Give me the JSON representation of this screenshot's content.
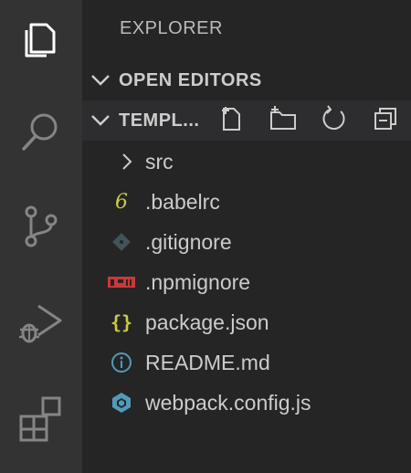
{
  "activity_bar": {
    "items": [
      {
        "icon": "files-icon",
        "active": true
      },
      {
        "icon": "search-icon",
        "active": false
      },
      {
        "icon": "source-control-icon",
        "active": false
      },
      {
        "icon": "run-debug-icon",
        "active": false
      },
      {
        "icon": "extensions-icon",
        "active": false
      }
    ]
  },
  "sidebar": {
    "title": "EXPLORER",
    "open_editors_label": "OPEN EDITORS",
    "project_label": "TEMPL...",
    "toolbar": [
      "new-file-icon",
      "new-folder-icon",
      "refresh-icon",
      "collapse-all-icon"
    ]
  },
  "tree": {
    "items": [
      {
        "label": "src",
        "icon": "chevron-right-icon"
      },
      {
        "label": ".babelrc",
        "icon": "babel-icon",
        "color": "#cbcb41"
      },
      {
        "label": ".gitignore",
        "icon": "git-icon",
        "color": "#41535b"
      },
      {
        "label": ".npmignore",
        "icon": "npm-icon",
        "color": "#cb3837"
      },
      {
        "label": "package.json",
        "icon": "json-icon",
        "color": "#cbcb41"
      },
      {
        "label": "README.md",
        "icon": "info-icon",
        "color": "#519aba"
      },
      {
        "label": "webpack.config.js",
        "icon": "webpack-icon",
        "color": "#519aba"
      }
    ]
  },
  "colors": {
    "activity_bar": "#333333",
    "sidebar": "#252526",
    "selected_header": "#2d2d2f",
    "text": "#cccccc"
  }
}
